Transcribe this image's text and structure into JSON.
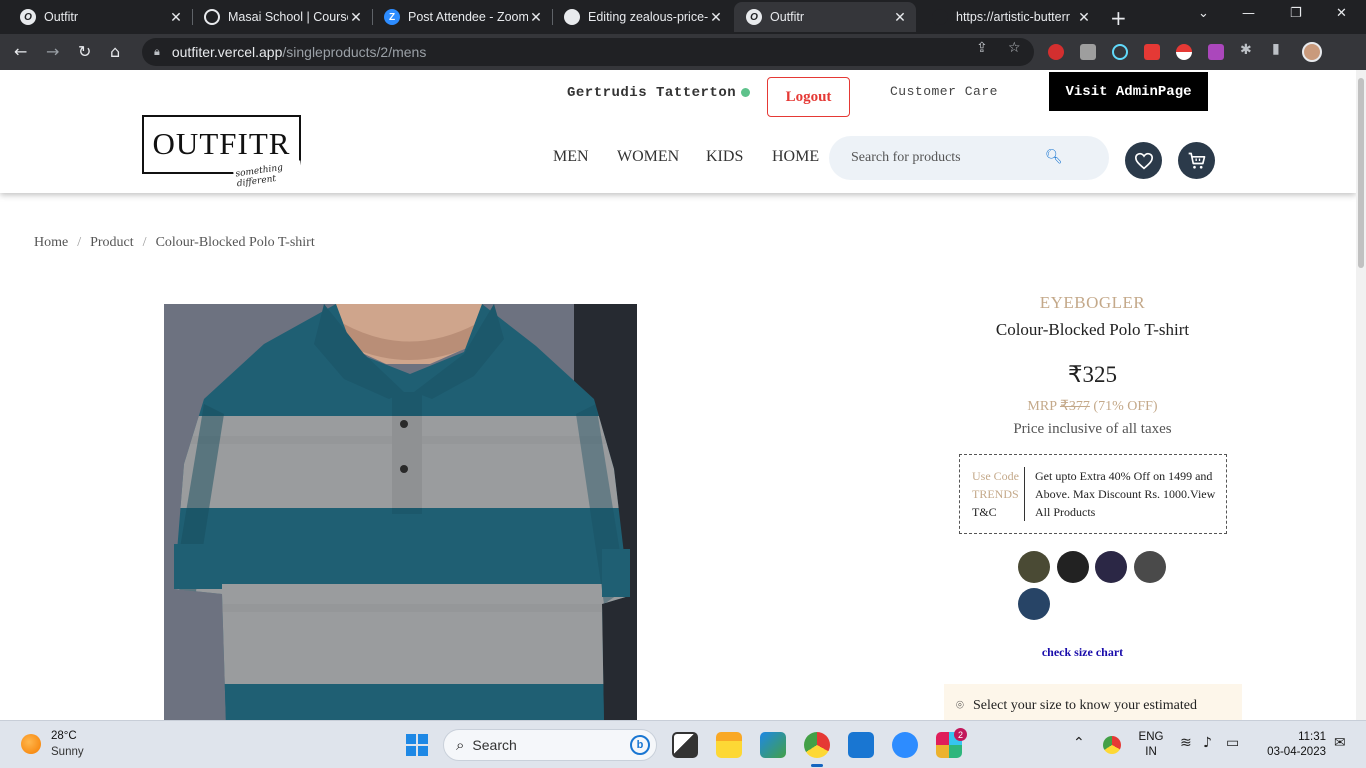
{
  "browser": {
    "tabs": [
      {
        "title": "Outfitr",
        "active": false
      },
      {
        "title": "Masai School | Course",
        "active": false
      },
      {
        "title": "Post Attendee - Zoom",
        "active": false
      },
      {
        "title": "Editing zealous-price-",
        "active": false
      },
      {
        "title": "Outfitr",
        "active": true
      },
      {
        "title": "https://artistic-butterr",
        "active": false
      }
    ],
    "url_host": "outfiter.vercel.app",
    "url_path": "/singleproducts/2/mens"
  },
  "header": {
    "username": "Gertrudis Tatterton",
    "logout_label": "Logout",
    "customer_care_label": "Customer Care",
    "admin_label": "Visit AdminPage",
    "logo_text": "OUTFITR",
    "logo_tagline": "something different",
    "nav": [
      "MEN",
      "WOMEN",
      "KIDS",
      "HOME"
    ],
    "search_placeholder": "Search for products",
    "accent_color": "#e53935",
    "icon_bg_color": "#2b3a4a"
  },
  "breadcrumb": [
    "Home",
    "Product",
    "Colour-Blocked Polo T-shirt"
  ],
  "product": {
    "brand": "EYEBOGLER",
    "name": "Colour-Blocked Polo T-shirt",
    "price": "₹325",
    "mrp_label": "MRP",
    "mrp_value": "₹377",
    "discount": "(71% OFF)",
    "tax_note": "Price inclusive of all taxes",
    "offer": {
      "code_label": "Use Code",
      "code": "TRENDS",
      "tc": "T&C",
      "text": "Get upto Extra 40% Off on 1499 and Above. Max Discount Rs. 1000.View All Products"
    },
    "swatches": [
      "#4a4a34",
      "#222222",
      "#2b2745",
      "#4a4a4a",
      "#274466"
    ],
    "size_chart_label": "check size chart",
    "delivery_text": "Select your size to know your estimated"
  },
  "taskbar": {
    "temperature": "28°C",
    "weather": "Sunny",
    "search_label": "Search",
    "lang_line1": "ENG",
    "lang_line2": "IN",
    "time": "11:31",
    "date": "03-04-2023",
    "badge_count": "2"
  }
}
